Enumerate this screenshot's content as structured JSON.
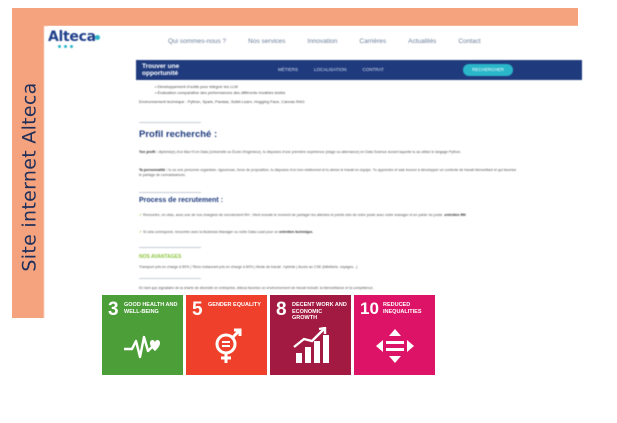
{
  "side_label": "Site internet Alteca",
  "site": {
    "logo": "Alteca",
    "nav": [
      "Qui sommes-nous ?",
      "Nos services",
      "Innovation",
      "Carrières",
      "Actualités",
      "Contact"
    ]
  },
  "bar": {
    "title": "Trouver une opportunité",
    "menu": [
      "MÉTIERS",
      "LOCALISATION",
      "CONTRAT"
    ],
    "button": "RECHERCHER"
  },
  "content": {
    "bullets": [
      "Développement d'outils pour intégrer les LLM",
      "Évaluation comparative des performances des différents modèles testés"
    ],
    "tech": "Environnement technique : Python, Spark, Pandas, Scikit-Learn, Hugging Face, Canvas RAG",
    "profile_title": "Profil recherché :",
    "profile_p1_lead": "Ton profil :",
    "profile_p1": "diplômé(e) d'un Bac+5 en Data (Université ou École d'ingénieur), tu disposes d'une première expérience (stage ou alternance) en Data Science durant laquelle tu as utilisé le langage Python.",
    "profile_p2_lead": "Ta personnalité :",
    "profile_p2": "tu es une personne organisée, rigoureuse, force de proposition, tu disposes d'un bon relationnel et tu aimes le travail en équipe. Tu apprécies et sais trouver à développer un contexte de travail bienveillant et qui favorise le partage de connaissances.",
    "process_title": "Process de recrutement :",
    "process_1": "Rencontre, en visio, avec une de nos chargées de recrutement RH ; Vient ensuite le moment de partager les attentes et points clés de notre poste avec notre manager et en parler du poste.",
    "process_1_em": "entretien RH",
    "process_2": "Si cela correspond, rencontre avec la Business Manager ou notre Data Lead pour un",
    "process_2_em": "entretien technique.",
    "advantages_title": "NOS AVANTAGES",
    "advantages": "Transport pris en charge à 50% | Titres restaurant pris en charge à 60% | Mode de travail : hybride | Accès au CSE (billetterie, voyages...)",
    "footer_note": "En tant que signataire de la charte de diversité en entreprise, Alteca favorise un environnement de travail inclusif, la bienveillance et la compétence."
  },
  "sdgs": [
    {
      "number": "3",
      "name": "GOOD HEALTH AND WELL-BEING",
      "color": "#4c9f38",
      "icon": "heartbeat-icon"
    },
    {
      "number": "5",
      "name": "GENDER EQUALITY",
      "color": "#ef402b",
      "icon": "gender-equality-icon"
    },
    {
      "number": "8",
      "name": "DECENT WORK AND ECONOMIC GROWTH",
      "color": "#a21942",
      "icon": "growth-chart-icon"
    },
    {
      "number": "10",
      "name": "REDUCED INEQUALITIES",
      "color": "#dd1367",
      "icon": "reduced-inequalities-icon"
    }
  ],
  "colors": {
    "frame": "#f5a37e",
    "navy": "#1f3b7e",
    "teal": "#2ab6c9",
    "green_accent": "#8cc63f"
  }
}
